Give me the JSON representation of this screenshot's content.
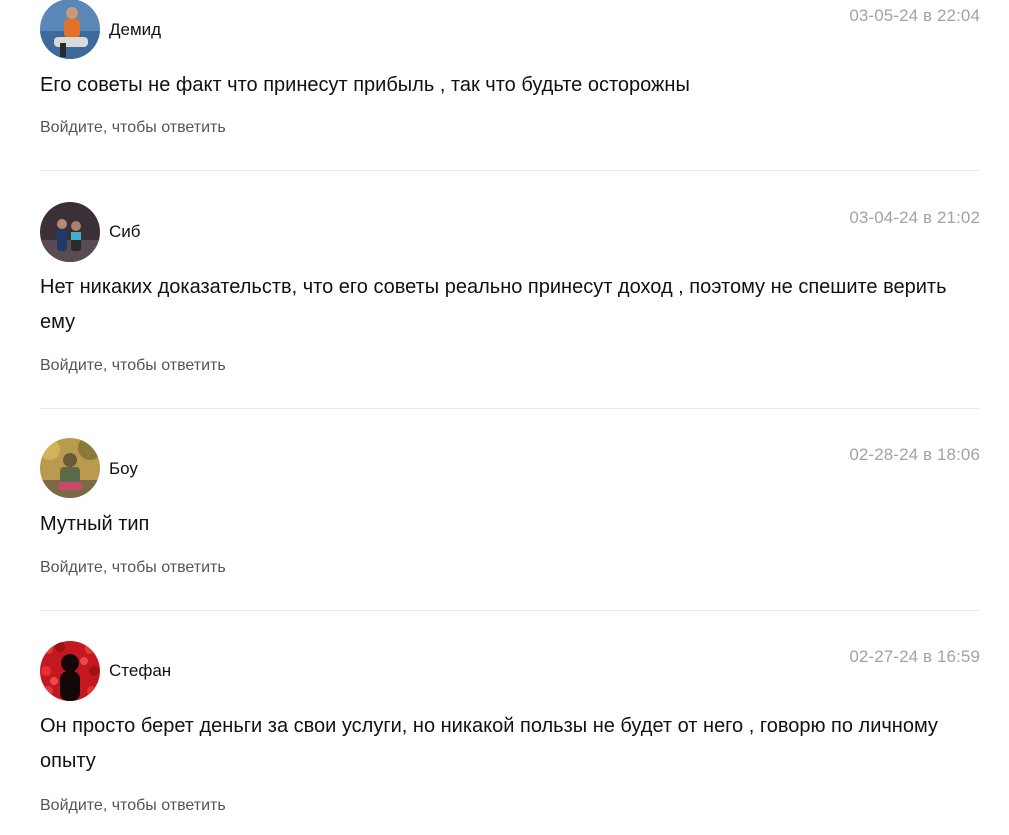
{
  "comments": [
    {
      "author": "Демид",
      "date": "03-05-24 в 22:04",
      "text": "Его советы не факт что принесут прибыль , так что будьте осторожны",
      "reply_label": "Войдите, чтобы ответить"
    },
    {
      "author": "Сиб",
      "date": "03-04-24 в 21:02",
      "text": "Нет никаких доказательств, что его советы реально принесут доход , поэтому не спешите верить ему",
      "reply_label": "Войдите, чтобы ответить"
    },
    {
      "author": "Боу",
      "date": "02-28-24 в 18:06",
      "text": "Мутный тип",
      "reply_label": "Войдите, чтобы ответить"
    },
    {
      "author": "Стефан",
      "date": "02-27-24 в 16:59",
      "text": "Он просто берет деньги за свои услуги, но никакой пользы не будет от него , говорю по личному опыту",
      "reply_label": "Войдите, чтобы ответить"
    }
  ],
  "colors": {
    "text": "#111111",
    "date": "#a2a2a9",
    "reply": "#555555",
    "divider": "#ececec"
  }
}
